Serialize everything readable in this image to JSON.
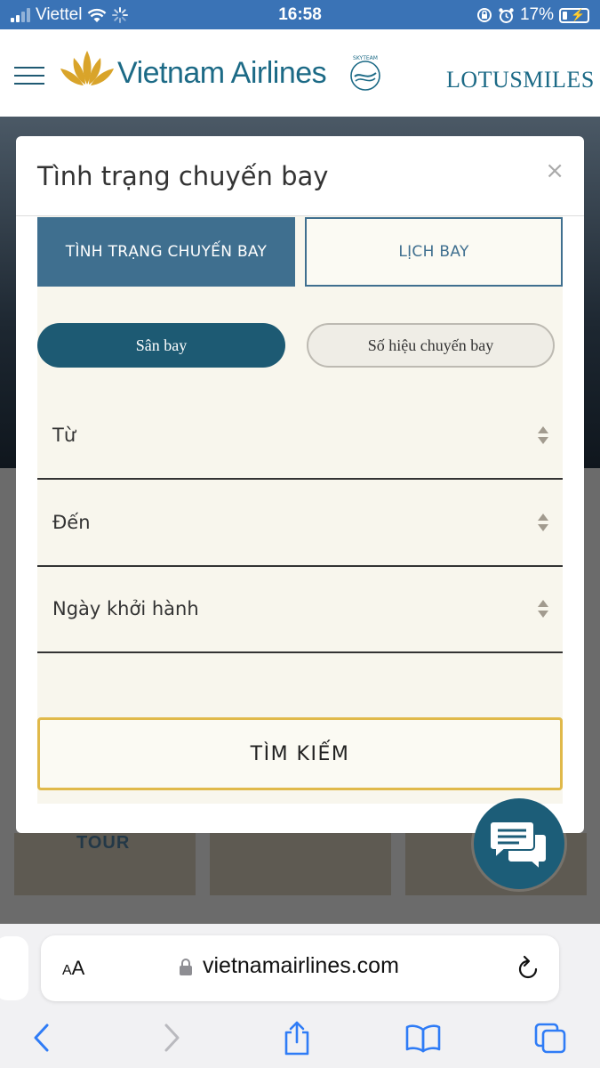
{
  "status_bar": {
    "carrier": "Viettel",
    "time": "16:58",
    "battery": "17%"
  },
  "header": {
    "brand": "Vietnam Airlines",
    "skyteam_mark": "SKYTEAM",
    "loyalty_brand": "LOTUSMILES"
  },
  "background": {
    "card_label": "TOUR"
  },
  "modal": {
    "title": "Tình trạng chuyến bay",
    "close_symbol": "×",
    "tabs": [
      {
        "label": "TÌNH TRẠNG CHUYẾN BAY",
        "active": true
      },
      {
        "label": "LỊCH BAY",
        "active": false
      }
    ],
    "search_modes": [
      {
        "label": "Sân bay",
        "active": true
      },
      {
        "label": "Số hiệu chuyến bay",
        "active": false
      }
    ],
    "fields": [
      {
        "label": "Từ"
      },
      {
        "label": "Đến"
      },
      {
        "label": "Ngày khởi hành"
      }
    ],
    "search_button": "TÌM KIẾM"
  },
  "browser": {
    "text_size_label": "AA",
    "url": "vietnamairlines.com"
  },
  "colors": {
    "brand_blue": "#1c6a86",
    "tab_active": "#3f6f8f",
    "pill_active": "#1d5a73",
    "search_border": "#e0b94a",
    "lotus_gold": "#d9a42a"
  }
}
